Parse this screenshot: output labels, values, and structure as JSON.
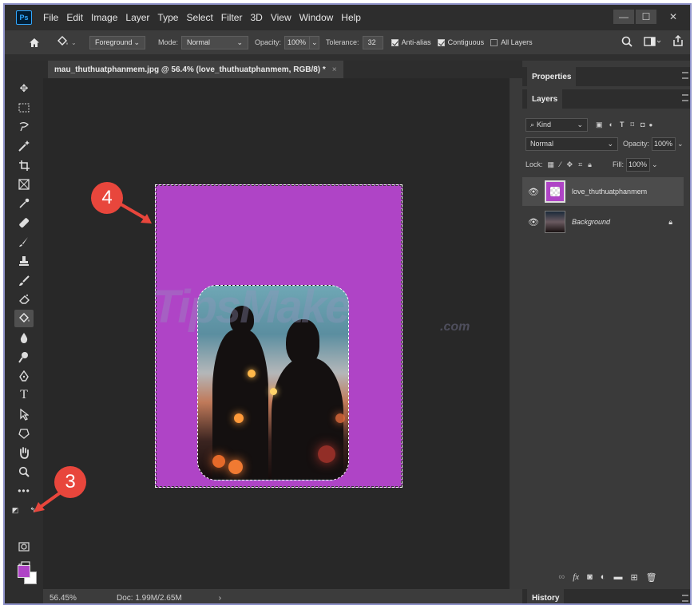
{
  "menubar": {
    "logo": "Ps",
    "items": [
      "File",
      "Edit",
      "Image",
      "Layer",
      "Type",
      "Select",
      "Filter",
      "3D",
      "View",
      "Window",
      "Help"
    ],
    "minimize": "—",
    "maximize": "☐",
    "close": "✕"
  },
  "options": {
    "fill_source": "Foreground",
    "mode_label": "Mode:",
    "mode_value": "Normal",
    "opacity_label": "Opacity:",
    "opacity_value": "100%",
    "tolerance_label": "Tolerance:",
    "tolerance_value": "32",
    "anti_alias": "Anti-alias",
    "contiguous": "Contiguous",
    "all_layers": "All Layers"
  },
  "document": {
    "tab_title": "mau_thuthuatphanmem.jpg @ 56.4% (love_thuthuatphanmem, RGB/8) *",
    "tab_close": "×",
    "zoom": "56.45%",
    "doc_size": "Doc: 1.99M/2.65M",
    "status_arrow": "›"
  },
  "colors": {
    "foreground": "#af44c6",
    "background": "#ffffff",
    "callout": "#e8463c"
  },
  "watermark": {
    "main": "TipsMake",
    "suffix": ".com"
  },
  "callouts": [
    "4",
    "3"
  ],
  "panels": {
    "properties": "Properties",
    "layers": "Layers",
    "history": "History",
    "filter_kind": "Kind",
    "blend_mode": "Normal",
    "opacity_label": "Opacity:",
    "opacity_value": "100%",
    "lock_label": "Lock:",
    "fill_label": "Fill:",
    "fill_value": "100%",
    "layers_list": [
      {
        "name": "love_thuthuatphanmem"
      },
      {
        "name": "Background"
      }
    ]
  },
  "icons": [
    "home-icon",
    "paint-bucket-icon",
    "move-icon",
    "marquee-icon",
    "lasso-icon",
    "magic-wand-icon",
    "crop-icon",
    "frame-icon",
    "eyedropper-icon",
    "healing-brush-icon",
    "brush-icon",
    "clone-stamp-icon",
    "history-brush-icon",
    "eraser-icon",
    "paint-bucket-icon",
    "blur-icon",
    "dodge-icon",
    "pen-icon",
    "type-icon",
    "path-select-icon",
    "custom-shape-icon",
    "hand-icon",
    "zoom-icon",
    "more-icon",
    "quick-mask-icon",
    "screen-mode-icon"
  ]
}
